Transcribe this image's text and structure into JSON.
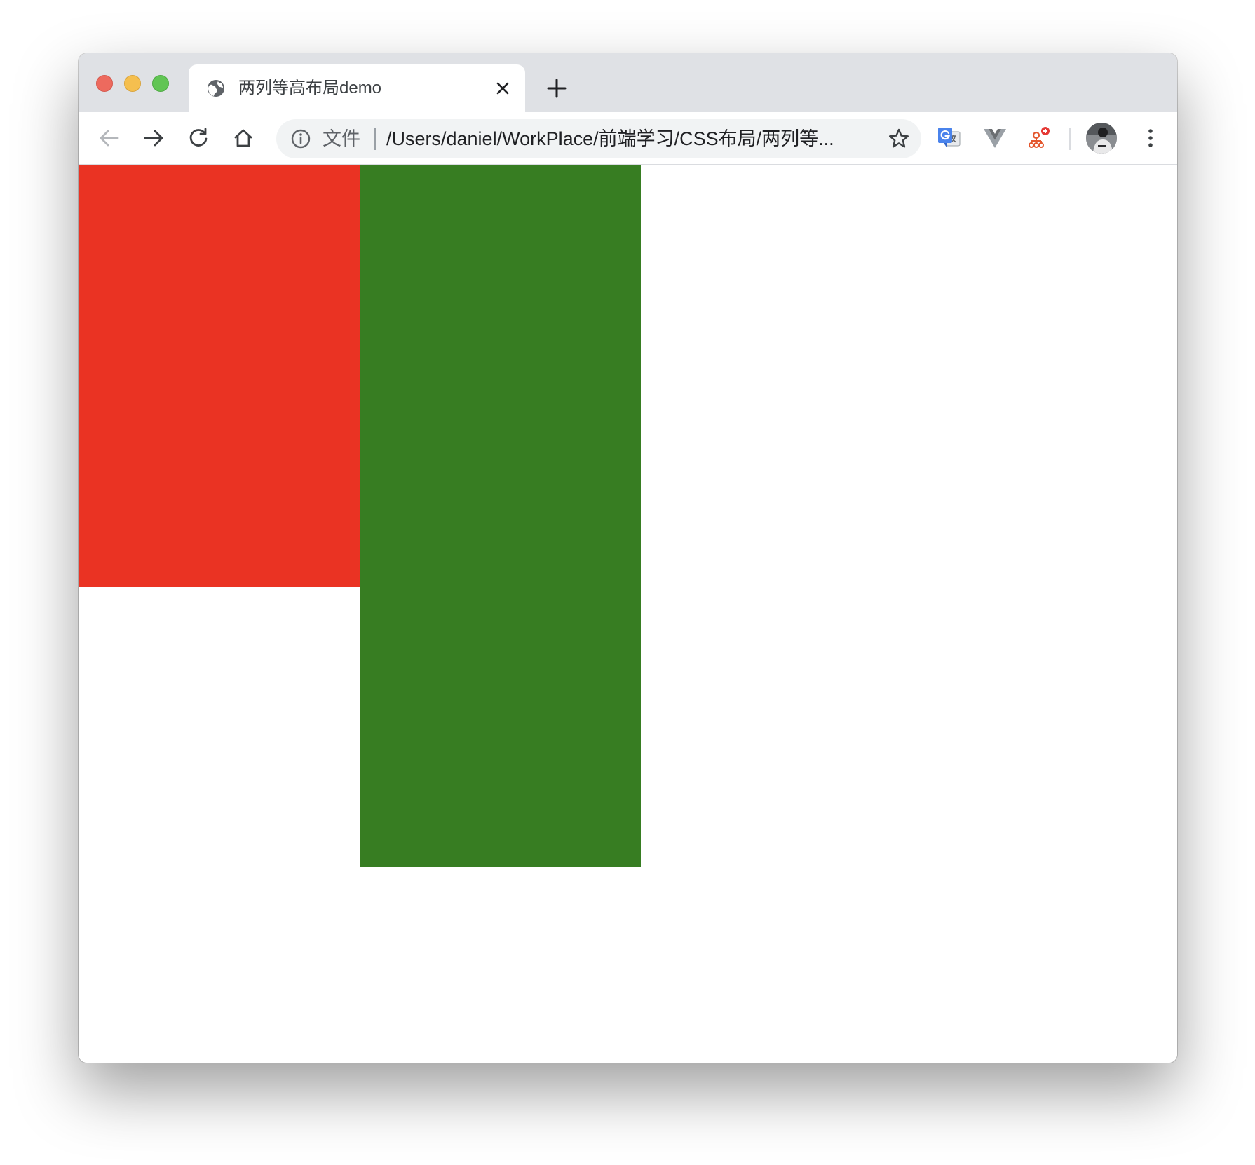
{
  "browser": {
    "tab": {
      "title": "两列等高布局demo",
      "favicon": "globe-icon"
    },
    "toolbar": {
      "back_icon": "arrow-left-icon",
      "forward_icon": "arrow-right-icon",
      "reload_icon": "reload-icon",
      "home_icon": "home-icon"
    },
    "omnibox": {
      "info_icon": "info-icon",
      "chip_label": "文件",
      "url": "/Users/daniel/WorkPlace/前端学习/CSS布局/两列等...",
      "star_icon": "star-icon"
    },
    "extensions": [
      "google-translate-icon",
      "vue-devtools-icon",
      "sitemap-extension-icon"
    ],
    "menu_icon": "kebab-menu-icon"
  },
  "page": {
    "columns": [
      {
        "name": "left-column",
        "color": "#ea3323"
      },
      {
        "name": "right-column",
        "color": "#377d22"
      }
    ]
  }
}
